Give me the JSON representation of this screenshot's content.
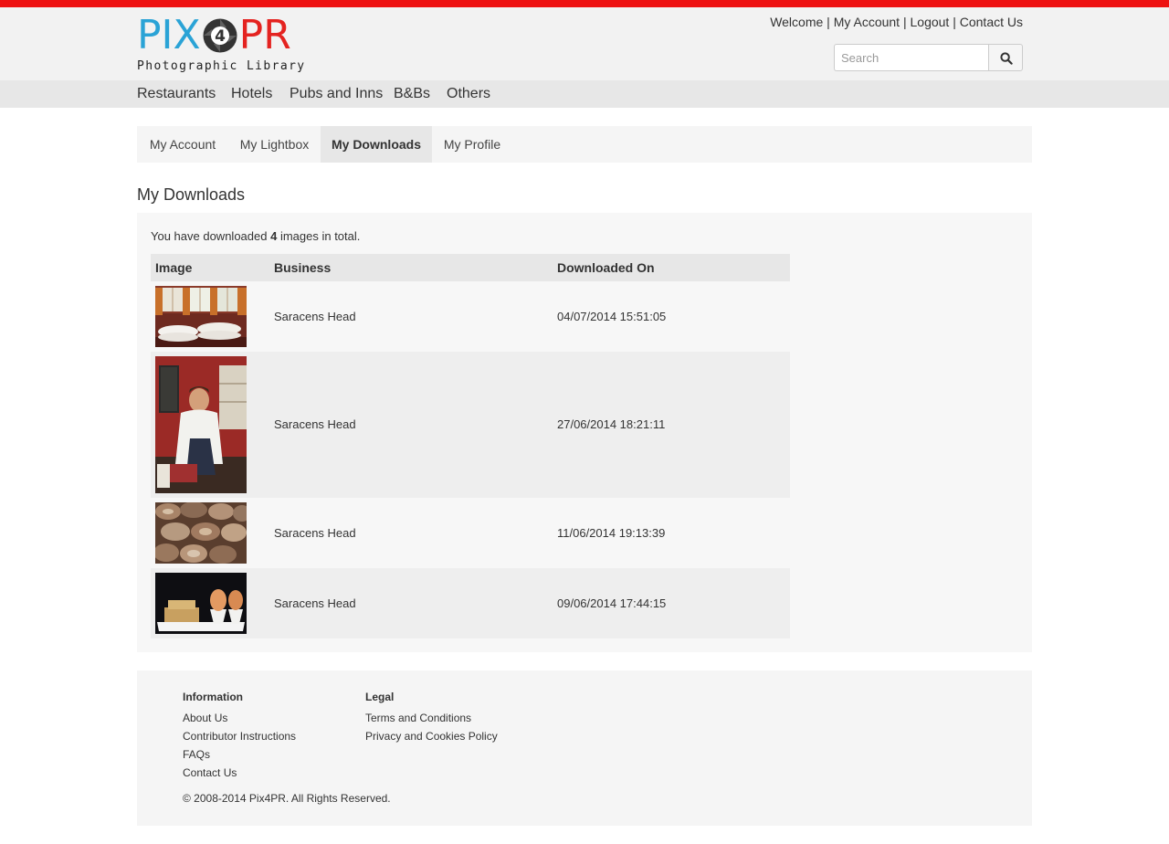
{
  "brand": {
    "logo_left": "PIX",
    "logo_mid": "4",
    "logo_right": "PR",
    "logo_subtitle": "Photographic Library",
    "color_blue": "#2aa3d6",
    "color_red": "#e42320"
  },
  "top_links": {
    "welcome": "Welcome",
    "sep": "|",
    "my_account": "My Account",
    "logout": "Logout",
    "contact": "Contact Us"
  },
  "search": {
    "placeholder": "Search",
    "value": "",
    "icon": "search-icon"
  },
  "nav": {
    "items": [
      {
        "label": "Restaurants"
      },
      {
        "label": "Hotels"
      },
      {
        "label": "Pubs and Inns"
      },
      {
        "label": "B&Bs"
      },
      {
        "label": "Others"
      }
    ]
  },
  "tabs": {
    "items": [
      {
        "label": "My Account",
        "active": false
      },
      {
        "label": "My Lightbox",
        "active": false
      },
      {
        "label": "My Downloads",
        "active": true
      },
      {
        "label": "My Profile",
        "active": false
      }
    ]
  },
  "page": {
    "title": "My Downloads",
    "summary_prefix": "You have downloaded ",
    "summary_count": "4",
    "summary_suffix": " images in total."
  },
  "table": {
    "headers": {
      "image": "Image",
      "business": "Business",
      "downloaded_on": "Downloaded On"
    },
    "rows": [
      {
        "business": "Saracens Head",
        "downloaded_on": "04/07/2014 15:51:05",
        "thumbnail": "restaurant-dining-room-photo"
      },
      {
        "business": "Saracens Head",
        "downloaded_on": "27/06/2014 18:21:11",
        "thumbnail": "chef-portrait-photo"
      },
      {
        "business": "Saracens Head",
        "downloaded_on": "11/06/2014 19:13:39",
        "thumbnail": "oysters-photo"
      },
      {
        "business": "Saracens Head",
        "downloaded_on": "09/06/2014 17:44:15",
        "thumbnail": "boiled-eggs-toast-photo"
      }
    ]
  },
  "footer": {
    "info_heading": "Information",
    "info_links": [
      {
        "label": "About Us"
      },
      {
        "label": "Contributor Instructions"
      },
      {
        "label": "FAQs"
      },
      {
        "label": "Contact Us"
      }
    ],
    "legal_heading": "Legal",
    "legal_links": [
      {
        "label": "Terms and Conditions"
      },
      {
        "label": "Privacy and Cookies Policy"
      }
    ],
    "copyright": "© 2008-2014 Pix4PR. All Rights Reserved."
  },
  "colors": {
    "top_bar": "#ee1111",
    "header_bg": "#f2f2f2",
    "nav_bg": "#e7e7e7",
    "panel_bg": "#f7f7f7"
  }
}
